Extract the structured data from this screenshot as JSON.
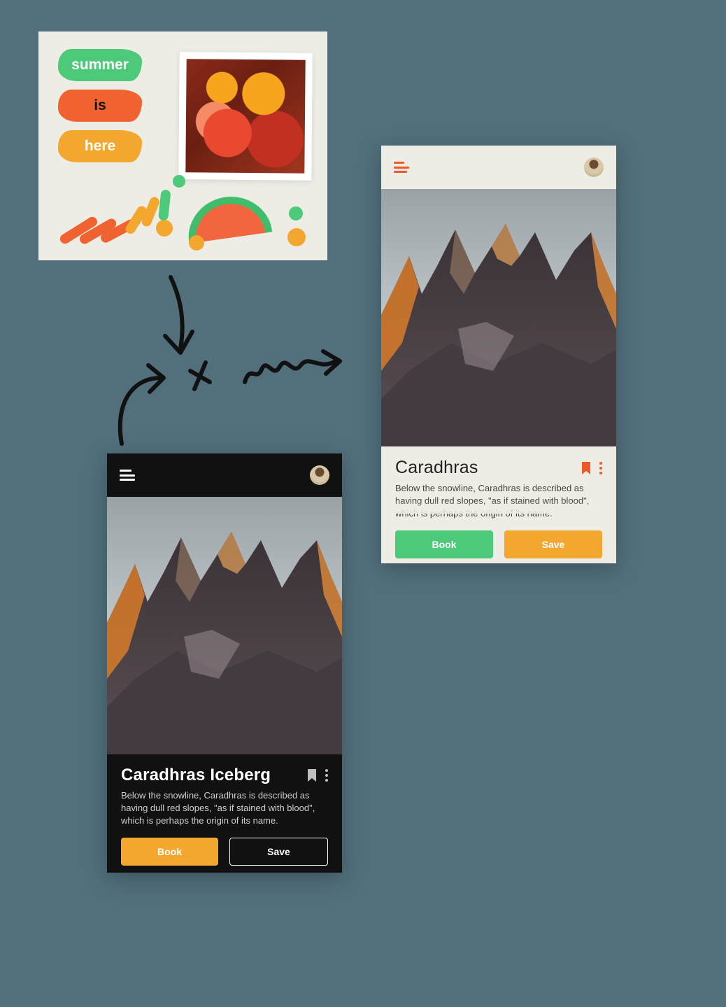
{
  "summer": {
    "word1": "summer",
    "word2": "is",
    "word3": "here"
  },
  "lightCard": {
    "title": "Caradhras",
    "description": "Below the snowline, Caradhras is described as having dull red slopes, \"as if stained with blood\", which is perhaps the origin of its name.",
    "bookLabel": "Book",
    "saveLabel": "Save",
    "bookmarkIcon": "bookmark-icon",
    "menuIcon": "kebab-icon"
  },
  "darkCard": {
    "title": "Caradhras Iceberg",
    "description": "Below the snowline, Caradhras is described as having dull red slopes, \"as if stained with blood\", which is perhaps the origin of its name.",
    "bookLabel": "Book",
    "saveLabel": "Save",
    "bookmarkIcon": "bookmark-icon",
    "menuIcon": "kebab-icon"
  },
  "colors": {
    "green": "#4dc97a",
    "orange": "#f3a72e",
    "red": "#ec5a2a",
    "bgLight": "#edece5",
    "bgDark": "#111111",
    "canvas": "#51707c"
  }
}
